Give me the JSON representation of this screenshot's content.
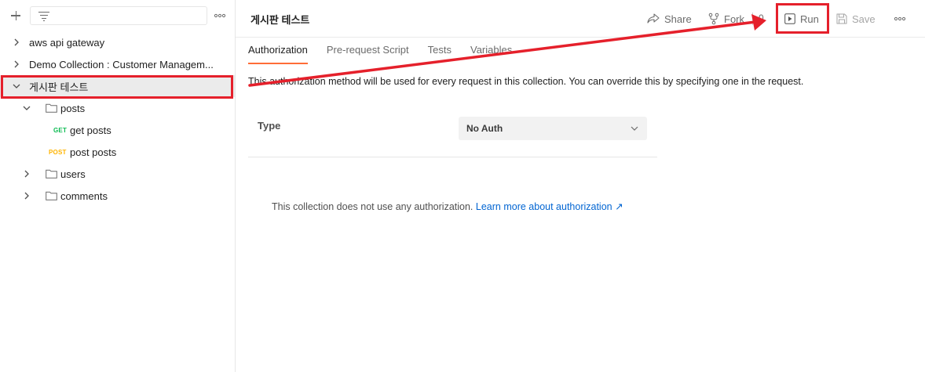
{
  "sidebar": {
    "filter_placeholder": "",
    "tree": [
      {
        "label": "aws api gateway",
        "expanded": false
      },
      {
        "label": "Demo Collection : Customer Managem...",
        "expanded": false
      },
      {
        "label": "게시판 테스트",
        "expanded": true,
        "selected": true
      },
      {
        "label": "posts",
        "expanded": true,
        "type": "folder"
      },
      {
        "label": "get posts",
        "method": "GET"
      },
      {
        "label": "post posts",
        "method": "POST"
      },
      {
        "label": "users",
        "expanded": false,
        "type": "folder"
      },
      {
        "label": "comments",
        "expanded": false,
        "type": "folder"
      }
    ]
  },
  "header": {
    "title": "게시판 테스트",
    "share_label": "Share",
    "fork_label": "Fork",
    "fork_count": "0",
    "run_label": "Run",
    "save_label": "Save"
  },
  "tabs": [
    {
      "label": "Authorization",
      "active": true
    },
    {
      "label": "Pre-request Script",
      "active": false
    },
    {
      "label": "Tests",
      "active": false
    },
    {
      "label": "Variables",
      "active": false
    }
  ],
  "auth": {
    "description": "This authorization method will be used for every request in this collection. You can override this by specifying one in the request.",
    "type_label": "Type",
    "type_value": "No Auth",
    "no_auth_text": "This collection does not use any authorization.",
    "learn_more": "Learn more about authorization ↗"
  },
  "colors": {
    "accent": "#ff6c37",
    "annotation": "#e5202b",
    "get": "#0cbb52",
    "post": "#ffb400",
    "link": "#0265d2"
  }
}
